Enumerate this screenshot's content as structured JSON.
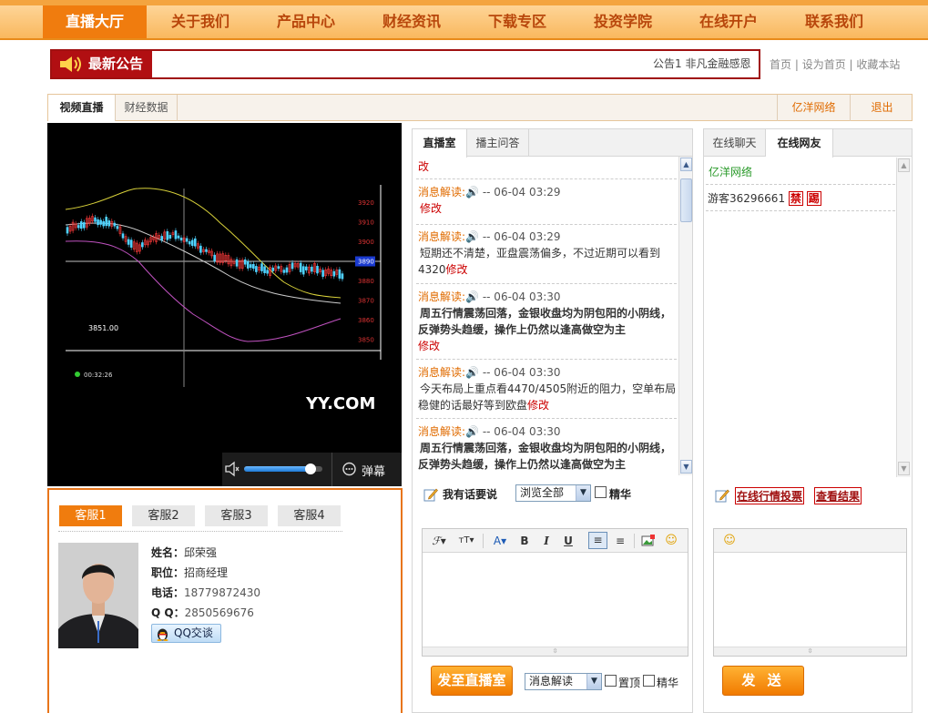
{
  "nav": {
    "items": [
      "直播大厅",
      "关于我们",
      "产品中心",
      "财经资讯",
      "下载专区",
      "投资学院",
      "在线开户",
      "联系我们"
    ]
  },
  "announcement": {
    "label": "最新公告",
    "text": "公告1   非凡金融感恩"
  },
  "toplinks": {
    "home": "首页",
    "set_home": "设为首页",
    "bookmark": "收藏本站"
  },
  "tabs": {
    "video": "视频直播",
    "finance": "财经数据",
    "company": "亿洋网络",
    "logout": "退出"
  },
  "video": {
    "watermark": "YY.COM",
    "price_labels": [
      "3920",
      "3910",
      "3900",
      "3890",
      "3880",
      "3870",
      "3860",
      "3850"
    ],
    "highlight_price": "3890",
    "low_label": "3851.00",
    "timer": "00:32:26",
    "danmu_label": "弹幕",
    "volume_level": 0.85
  },
  "service": {
    "tabs": [
      "客服1",
      "客服2",
      "客服3",
      "客服4"
    ],
    "name_label": "姓名：",
    "name": "邱荣强",
    "role_label": "职位：",
    "role": "招商经理",
    "phone_label": "电话：",
    "phone": "18779872430",
    "qq_label": "Q Q：",
    "qq": "2850569676",
    "qq_button": "QQ交谈"
  },
  "chatroom": {
    "tabs": [
      "直播室",
      "播主问答"
    ],
    "top_partial": "改",
    "messages": [
      {
        "tag": "消息解读:",
        "time": "-- 06-04 03:29",
        "body": "",
        "bold": false,
        "edit": "修改"
      },
      {
        "tag": "消息解读:",
        "time": "-- 06-04 03:29",
        "body": "短期还不清楚，亚盘震荡偏多，不过近期可以看到4320",
        "bold": false,
        "edit": "修改"
      },
      {
        "tag": "消息解读:",
        "time": "-- 06-04 03:30",
        "body": "周五行情震荡回落，金银收盘均为阴包阳的小阴线，反弹势头趋缓，操作上仍然以逢高做空为主",
        "bold": true,
        "edit": "修改"
      },
      {
        "tag": "消息解读:",
        "time": "-- 06-04 03:30",
        "body": "今天布局上重点看4470/4505附近的阻力，空单布局稳健的话最好等到欧盘",
        "bold": false,
        "edit": "修改"
      },
      {
        "tag": "消息解读:",
        "time": "-- 06-04 03:30",
        "body": "周五行情震荡回落，金银收盘均为阴包阳的小阴线，反弹势头趋缓，操作上仍然以逢高做空为主",
        "bold": true,
        "edit": ""
      }
    ],
    "say_label": "我有话要说",
    "filter_value": "浏览全部",
    "essence_label": "精华",
    "send_button": "发至直播室",
    "type_value": "消息解读",
    "pin_label": "置顶",
    "essence2_label": "精华"
  },
  "online": {
    "tabs": [
      "在线聊天",
      "在线网友"
    ],
    "company": "亿洋网络",
    "guest": "游客36296661",
    "ban": "禁",
    "kick": "踢",
    "vote_link": "在线行情投票",
    "result_link": "查看结果",
    "send_button": "发 送"
  },
  "colors": {
    "accent": "#f07c0e",
    "brand_red": "#b10f12",
    "link_orange": "#e06b00"
  }
}
